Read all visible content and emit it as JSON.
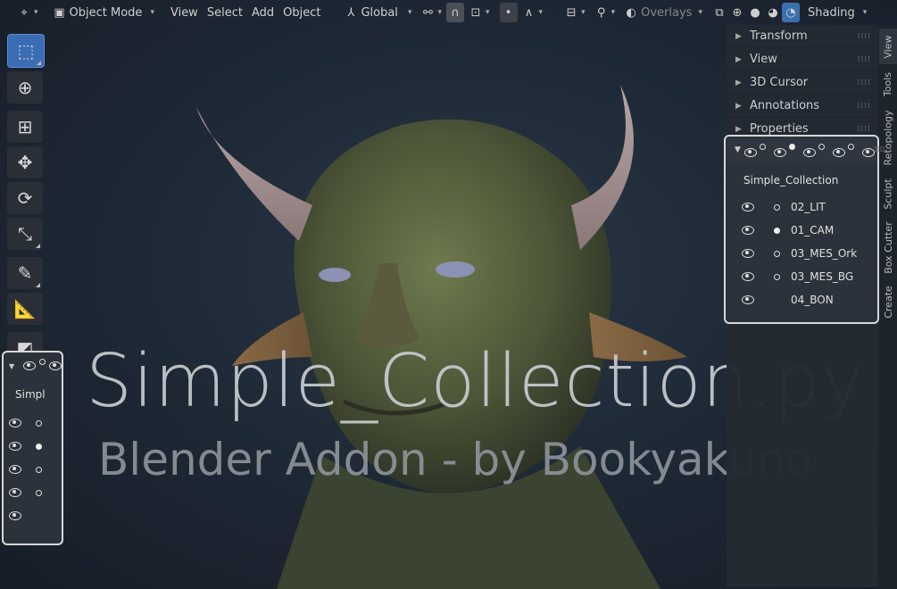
{
  "header": {
    "mode_label": "Object Mode",
    "menus": [
      "View",
      "Select",
      "Add",
      "Object"
    ],
    "orientation_label": "Global",
    "overlays_label": "Overlays",
    "shading_label": "Shading"
  },
  "toolbar": {
    "tools": [
      "select-box-icon",
      "cursor-icon",
      "move-icon",
      "transform-arrows-icon",
      "rotate-icon",
      "scale-icon",
      "annotate-icon",
      "measure-icon",
      "add-cube-icon"
    ]
  },
  "overlay_text": {
    "title": "Simple_Collection.py",
    "subtitle": "Blender Addon - by Bookyakuno"
  },
  "sidebar": {
    "panels": [
      "Transform",
      "View",
      "3D Cursor",
      "Annotations",
      "Properties"
    ],
    "tabs": [
      "View",
      "Tools",
      "Retopology",
      "Sculpt",
      "Box Cutter",
      "Create"
    ]
  },
  "collection_panel": {
    "title": "Simple_Collection",
    "rows": [
      {
        "name": "02_LIT",
        "dot": "hollow"
      },
      {
        "name": "01_CAM",
        "dot": "filled"
      },
      {
        "name": "03_MES_Ork",
        "dot": "hollow"
      },
      {
        "name": "03_MES_BG",
        "dot": "hollow"
      },
      {
        "name": "04_BON",
        "dot": "none"
      }
    ]
  },
  "collection_panel_small": {
    "title": "Simpl"
  }
}
